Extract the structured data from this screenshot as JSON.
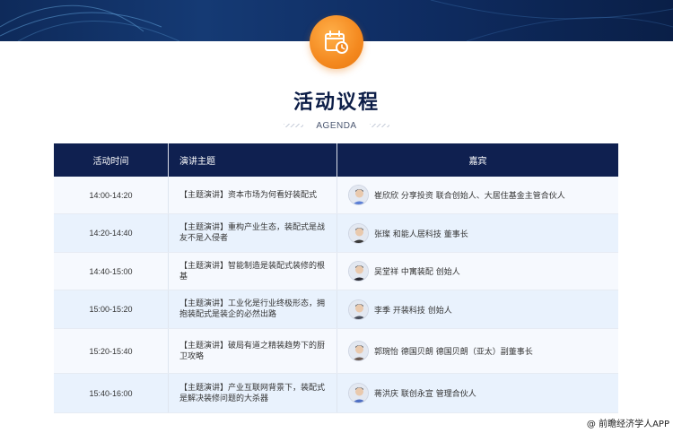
{
  "header": {
    "badge_icon": "calendar-clock-icon",
    "title": "活动议程",
    "subtitle": "AGENDA"
  },
  "table": {
    "columns": [
      "活动时间",
      "演讲主题",
      "嘉宾"
    ],
    "rows": [
      {
        "time": "14:00-14:20",
        "topic": "【主题演讲】资本市场为何看好装配式",
        "guest": "崔欣欣 分享投资 联合创始人、大居住基金主管合伙人",
        "avatar_color": "#5c7fd6"
      },
      {
        "time": "14:20-14:40",
        "topic": "【主题演讲】重构产业生态，装配式是战友不是入侵者",
        "guest": "张璨 和能人居科技 董事长",
        "avatar_color": "#3a3a3a"
      },
      {
        "time": "14:40-15:00",
        "topic": "【主题演讲】智能制造是装配式装修的根基",
        "guest": "吴堂祥 中寓装配 创始人",
        "avatar_color": "#2b2b33"
      },
      {
        "time": "15:00-15:20",
        "topic": "【主题演讲】工业化是行业终极形态，拥抱装配式是装企的必然出路",
        "guest": "李季 开装科技 创始人",
        "avatar_color": "#4a4f5c"
      },
      {
        "time": "15:20-15:40",
        "topic": "【主题演讲】破局有道之精装趋势下的厨卫攻略",
        "guest": "郭琬怡 德国贝朗 德国贝朗（亚太）副董事长",
        "avatar_color": "#6b5a52"
      },
      {
        "time": "15:40-16:00",
        "topic": "【主题演讲】产业互联网背景下，装配式是解决装修问题的大杀器",
        "guest": "蒋洪庆 联创永宣 管理合伙人",
        "avatar_color": "#4e6fc4"
      }
    ]
  },
  "watermark": "@ 前瞻经济学人APP"
}
